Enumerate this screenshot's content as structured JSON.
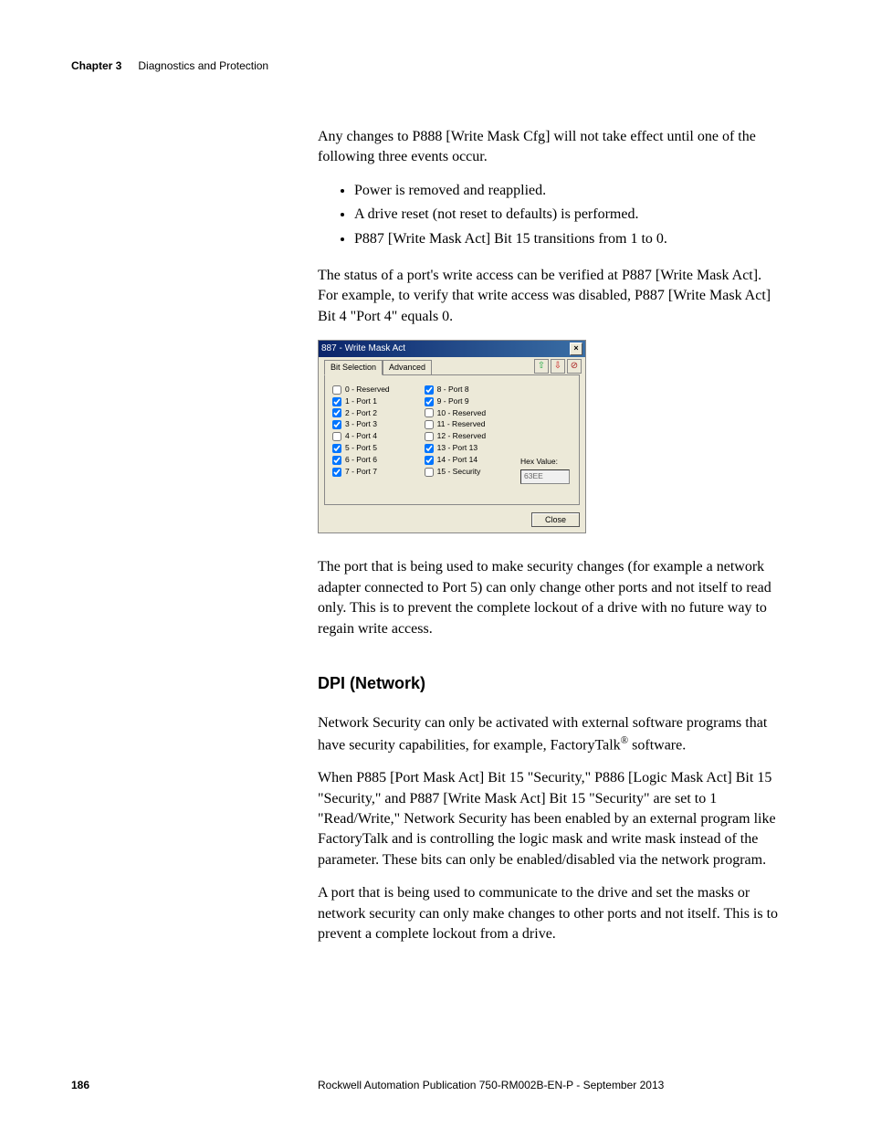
{
  "header": {
    "chapter": "Chapter 3",
    "title": "Diagnostics and Protection"
  },
  "body": {
    "p1": "Any changes to P888 [Write Mask Cfg] will not take effect until one of the following three events occur.",
    "bullets": [
      "Power is removed and reapplied.",
      "A drive reset (not reset to defaults) is performed.",
      "P887 [Write Mask Act] Bit 15 transitions from 1 to 0."
    ],
    "p2": "The status of a port's write access can be verified at P887 [Write Mask Act]. For example, to verify that write access was disabled, P887 [Write Mask Act] Bit 4 \"Port 4\" equals 0.",
    "p3": "The port that is being used to make security changes (for example a network adapter connected to Port 5) can only change other ports and not itself to read only. This is to prevent the complete lockout of a drive with no future way to regain write access.",
    "h2": "DPI (Network)",
    "p4a": "Network Security can only be activated with external software programs that have security capabilities, for example, FactoryTalk",
    "p4b": " software.",
    "p5": "When P885 [Port Mask Act] Bit 15 \"Security,\" P886 [Logic Mask Act] Bit 15 \"Security,\" and P887 [Write Mask Act] Bit 15 \"Security\" are set to 1 \"Read/Write,\" Network Security has been enabled by an external program like FactoryTalk and is controlling the logic mask and write mask instead of the parameter. These bits can only be enabled/disabled via the network program.",
    "p6": "A port that is being used to communicate to the drive and set the masks or network security can only make changes to other ports and not itself. This is to prevent a complete lockout from a drive."
  },
  "dialog": {
    "title": "887 - Write Mask Act",
    "tabs": {
      "t1": "Bit Selection",
      "t2": "Advanced"
    },
    "toolbar": {
      "up": "⇧",
      "down": "⇩",
      "stop": "⊘"
    },
    "bits_left": [
      {
        "label": "0 - Reserved",
        "checked": false
      },
      {
        "label": "1 - Port 1",
        "checked": true
      },
      {
        "label": "2 - Port 2",
        "checked": true
      },
      {
        "label": "3 - Port 3",
        "checked": true
      },
      {
        "label": "4 - Port 4",
        "checked": false
      },
      {
        "label": "5 - Port 5",
        "checked": true
      },
      {
        "label": "6 - Port 6",
        "checked": true
      },
      {
        "label": "7 - Port 7",
        "checked": true
      }
    ],
    "bits_right": [
      {
        "label": "8 - Port 8",
        "checked": true
      },
      {
        "label": "9 - Port 9",
        "checked": true
      },
      {
        "label": "10 - Reserved",
        "checked": false
      },
      {
        "label": "11 - Reserved",
        "checked": false
      },
      {
        "label": "12 - Reserved",
        "checked": false
      },
      {
        "label": "13 - Port 13",
        "checked": true
      },
      {
        "label": "14 - Port 14",
        "checked": true
      },
      {
        "label": "15 - Security",
        "checked": false
      }
    ],
    "hex_label": "Hex Value:",
    "hex_value": "63EE",
    "close": "Close"
  },
  "footer": {
    "page": "186",
    "pub": "Rockwell Automation Publication 750-RM002B-EN-P - September 2013"
  }
}
